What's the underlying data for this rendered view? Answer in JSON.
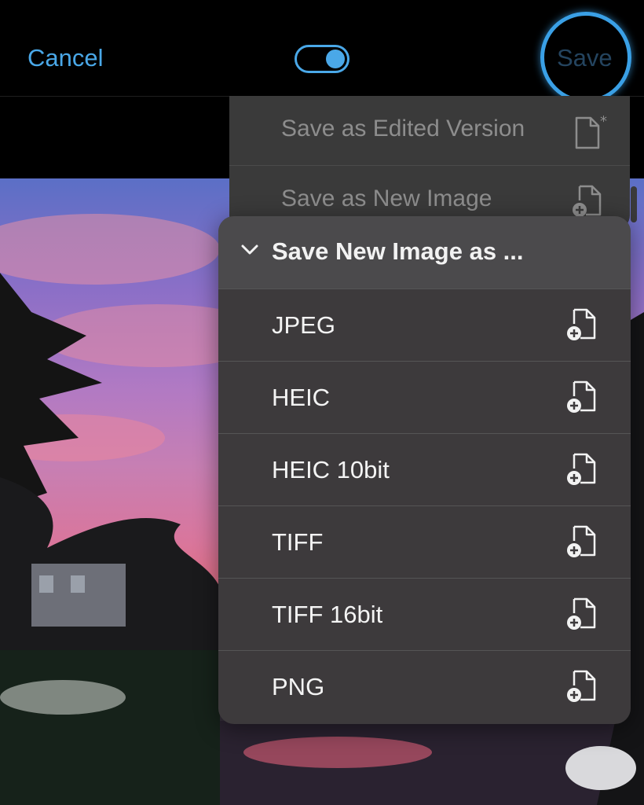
{
  "topbar": {
    "cancel_label": "Cancel",
    "save_label": "Save",
    "toggle_state": "on",
    "accent_color": "#4aa8e8"
  },
  "save_menu": {
    "items": [
      {
        "label": "Save as Edited Version",
        "icon": "document-edited-icon"
      },
      {
        "label": "Save as New Image",
        "icon": "document-add-icon"
      }
    ]
  },
  "submenu": {
    "title": "Save New Image as ...",
    "icon": "chevron-down-icon",
    "options": [
      {
        "label": "JPEG",
        "icon": "document-add-icon"
      },
      {
        "label": "HEIC",
        "icon": "document-add-icon"
      },
      {
        "label": "HEIC 10bit",
        "icon": "document-add-icon"
      },
      {
        "label": "TIFF",
        "icon": "document-add-icon"
      },
      {
        "label": "TIFF 16bit",
        "icon": "document-add-icon"
      },
      {
        "label": "PNG",
        "icon": "document-add-icon"
      }
    ]
  }
}
